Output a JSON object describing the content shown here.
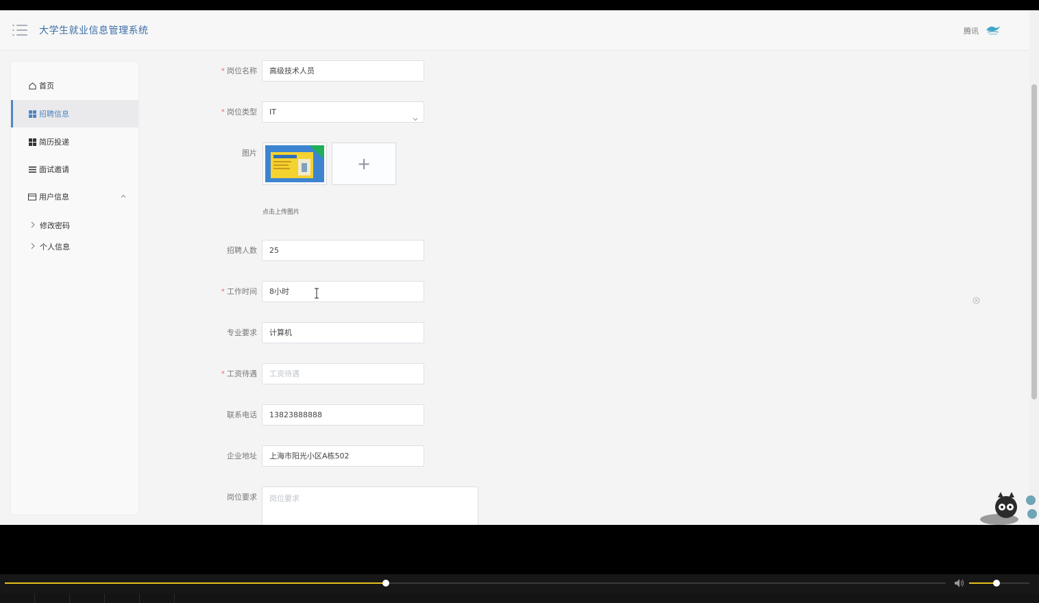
{
  "app": {
    "title": "大学生就业信息管理系统",
    "user": "腾讯"
  },
  "sidebar": {
    "items": [
      {
        "label": "首页",
        "icon": "home-icon"
      },
      {
        "label": "招聘信息",
        "icon": "grid-icon",
        "active": true
      },
      {
        "label": "简历投递",
        "icon": "grid-icon"
      },
      {
        "label": "面试邀请",
        "icon": "list-icon"
      },
      {
        "label": "用户信息",
        "icon": "card-icon"
      }
    ],
    "subitems": [
      {
        "label": "修改密码"
      },
      {
        "label": "个人信息"
      }
    ]
  },
  "form": {
    "position_name": {
      "label": "岗位名称",
      "value": "高级技术人员"
    },
    "position_type": {
      "label": "岗位类型",
      "value": "IT"
    },
    "image": {
      "label": "图片",
      "upload_tip": "点击上传图片",
      "plus": "+"
    },
    "headcount": {
      "label": "招聘人数",
      "value": "25"
    },
    "work_time": {
      "label": "工作时间",
      "value": "8小时"
    },
    "major": {
      "label": "专业要求",
      "value": "计算机"
    },
    "salary": {
      "label": "工资待遇",
      "placeholder": "工资待遇"
    },
    "phone": {
      "label": "联系电话",
      "value": "13823888888"
    },
    "address": {
      "label": "企业地址",
      "value": "上海市阳光小区A栋502"
    },
    "requirements": {
      "label": "岗位要求",
      "placeholder": "岗位要求"
    }
  },
  "player": {
    "progress": 0.405,
    "volume": 0.45
  },
  "colors": {
    "accent": "#4e86c4",
    "required": "#f56c6c",
    "progress": "#e7c21c"
  }
}
